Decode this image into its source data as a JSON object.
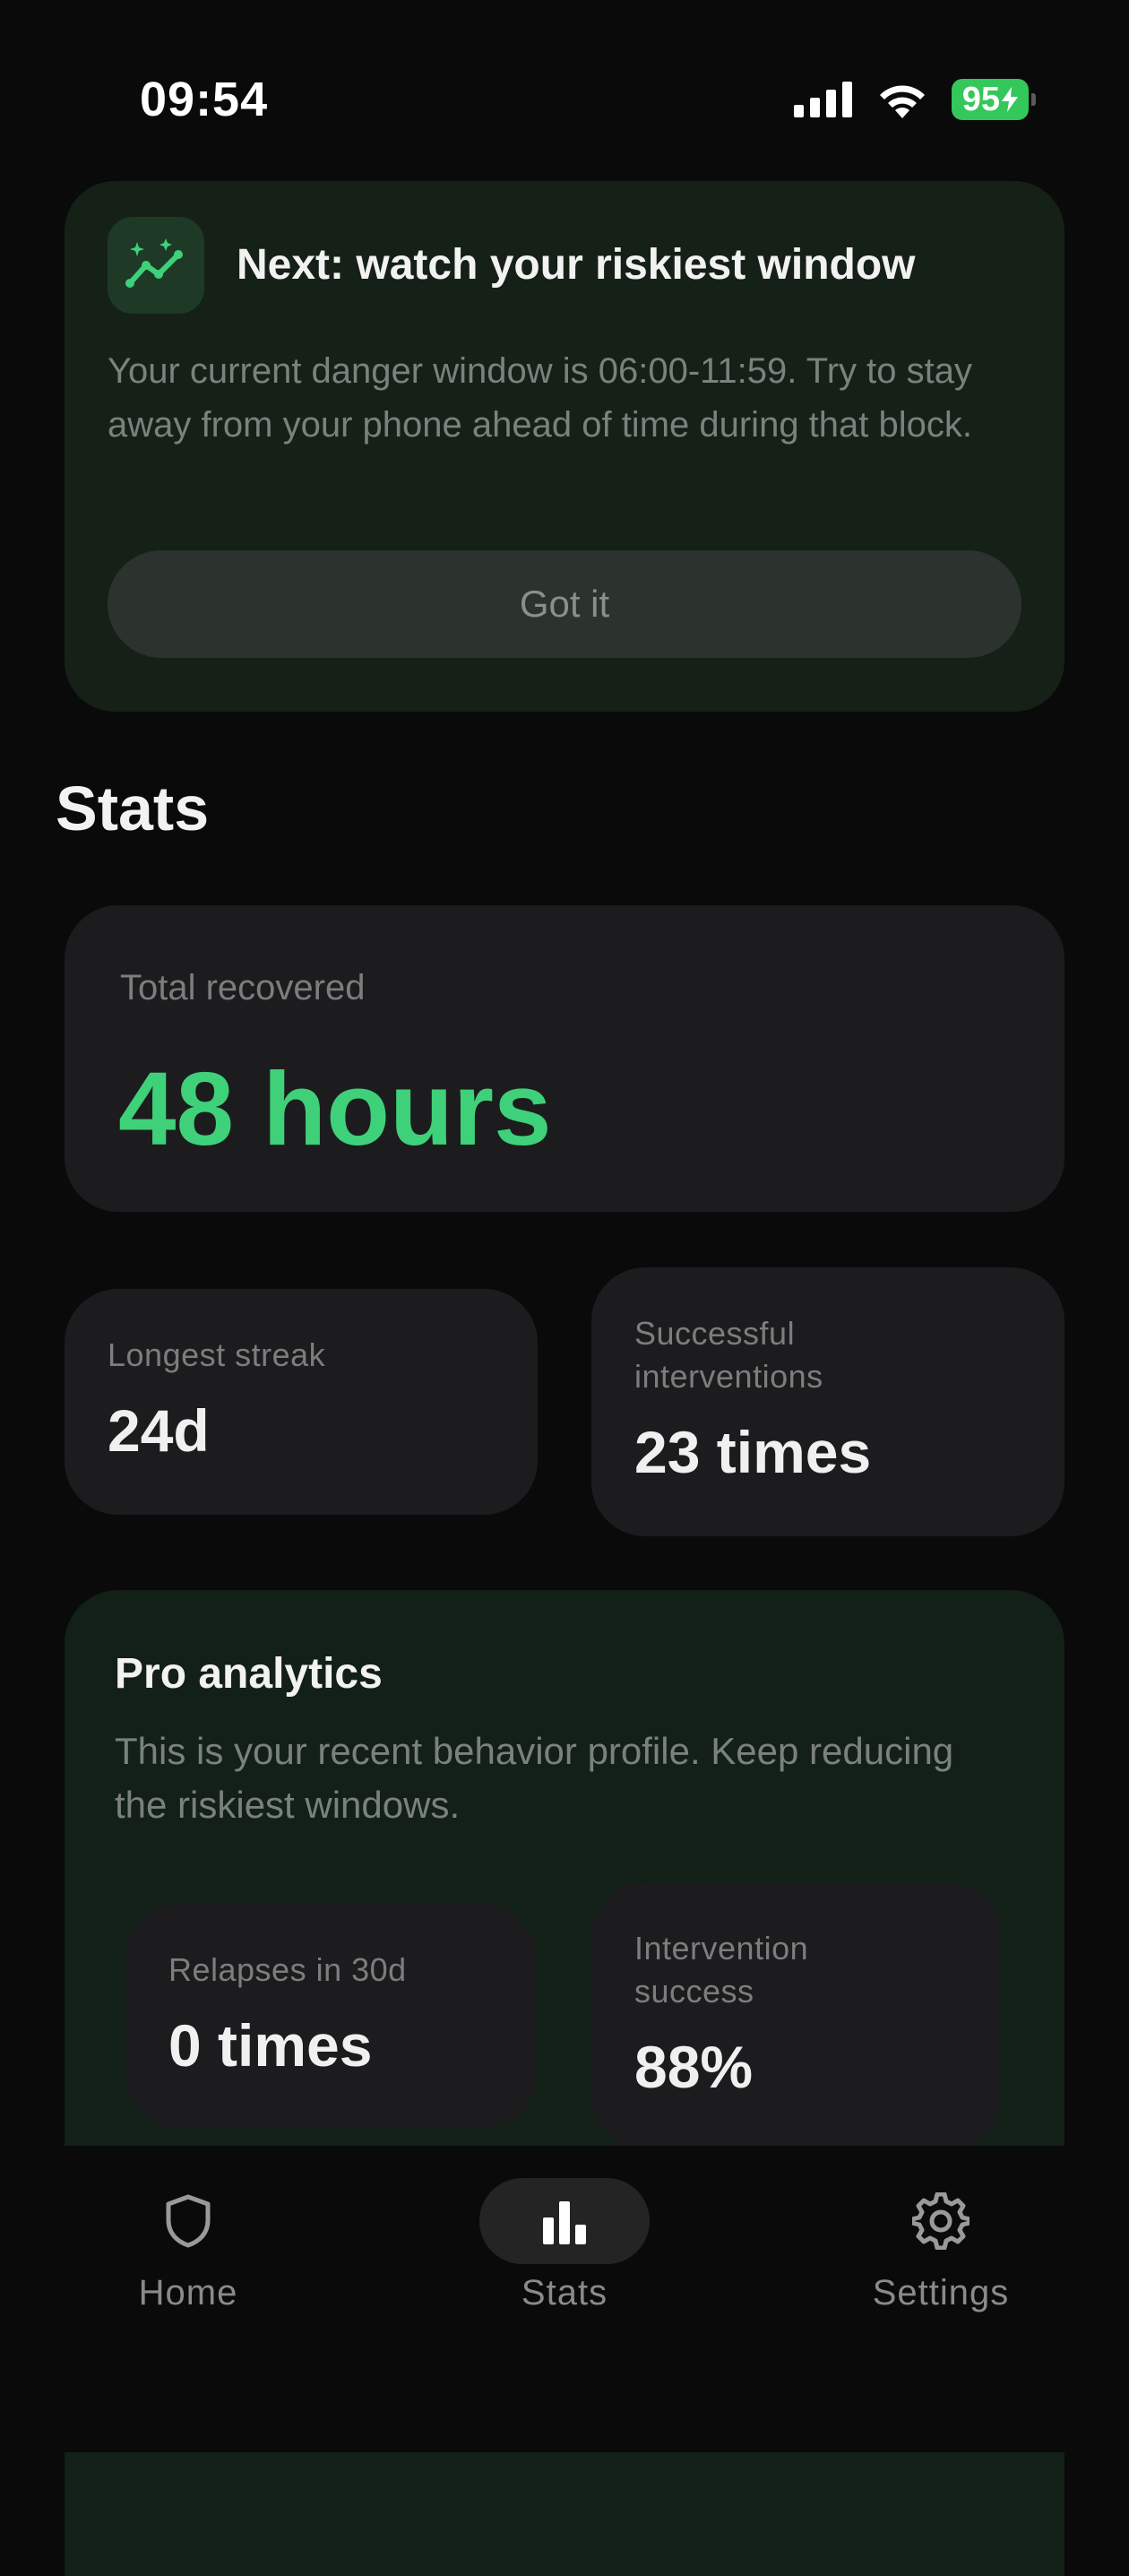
{
  "status_bar": {
    "time": "09:54",
    "battery": "95",
    "icons": [
      "cellular-signal-icon",
      "wifi-icon",
      "battery-charging-icon"
    ]
  },
  "tip_card": {
    "icon": "trend-sparkle-icon",
    "title": "Next: watch your riskiest window",
    "body": "Your current danger window is 06:00-11:59. Try to stay away from your phone ahead of time during that block.",
    "button_label": "Got it"
  },
  "stats": {
    "title": "Stats",
    "total": {
      "label": "Total recovered",
      "value": "48 hours"
    },
    "longest_streak": {
      "label": "Longest streak",
      "value": "24d"
    },
    "successful_interventions": {
      "label": "Successful interventions",
      "value": "23 times"
    }
  },
  "pro_analytics": {
    "title": "Pro analytics",
    "body": "This is your recent behavior profile. Keep reducing the riskiest windows.",
    "relapses": {
      "label": "Relapses in 30d",
      "value": "0 times"
    },
    "intervention_success": {
      "label": "Intervention success",
      "value": "88%"
    }
  },
  "tabbar": {
    "items": [
      {
        "label": "Home",
        "icon": "shield-icon",
        "active": false
      },
      {
        "label": "Stats",
        "icon": "bar-chart-icon",
        "active": true
      },
      {
        "label": "Settings",
        "icon": "gear-icon",
        "active": false
      }
    ]
  },
  "colors": {
    "accent_green": "#3fd07a",
    "background": "#0a0a0a",
    "card": "#1c1c1e",
    "tip_card": "#152017",
    "pro_card": "#122017"
  }
}
